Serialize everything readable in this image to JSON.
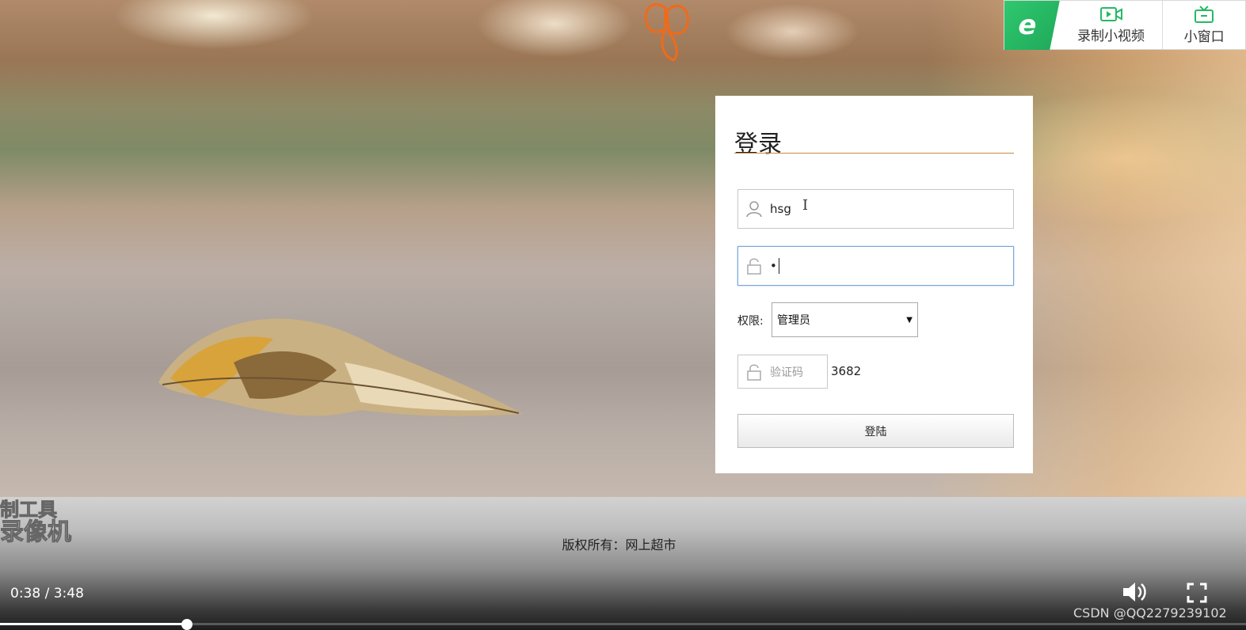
{
  "video_helper": {
    "record_label": "录制小视频",
    "mini_label": "小窗口",
    "accent": "#27b864"
  },
  "login": {
    "title": "登录",
    "username_value": "hsg",
    "password_mask": "•",
    "permission_label": "权限:",
    "permission_selected": "管理员",
    "captcha_placeholder": "验证码",
    "captcha_code": "3682",
    "submit_label": "登陆"
  },
  "footer": {
    "watermark_line1": "制工具",
    "watermark_line2": "录像机",
    "copyright": "版权所有：网上超市"
  },
  "player": {
    "current_time": "0:38",
    "separator": " / ",
    "duration": "3:48",
    "progress_fraction": 0.15
  },
  "source_mark": "CSDN @QQ2279239102"
}
